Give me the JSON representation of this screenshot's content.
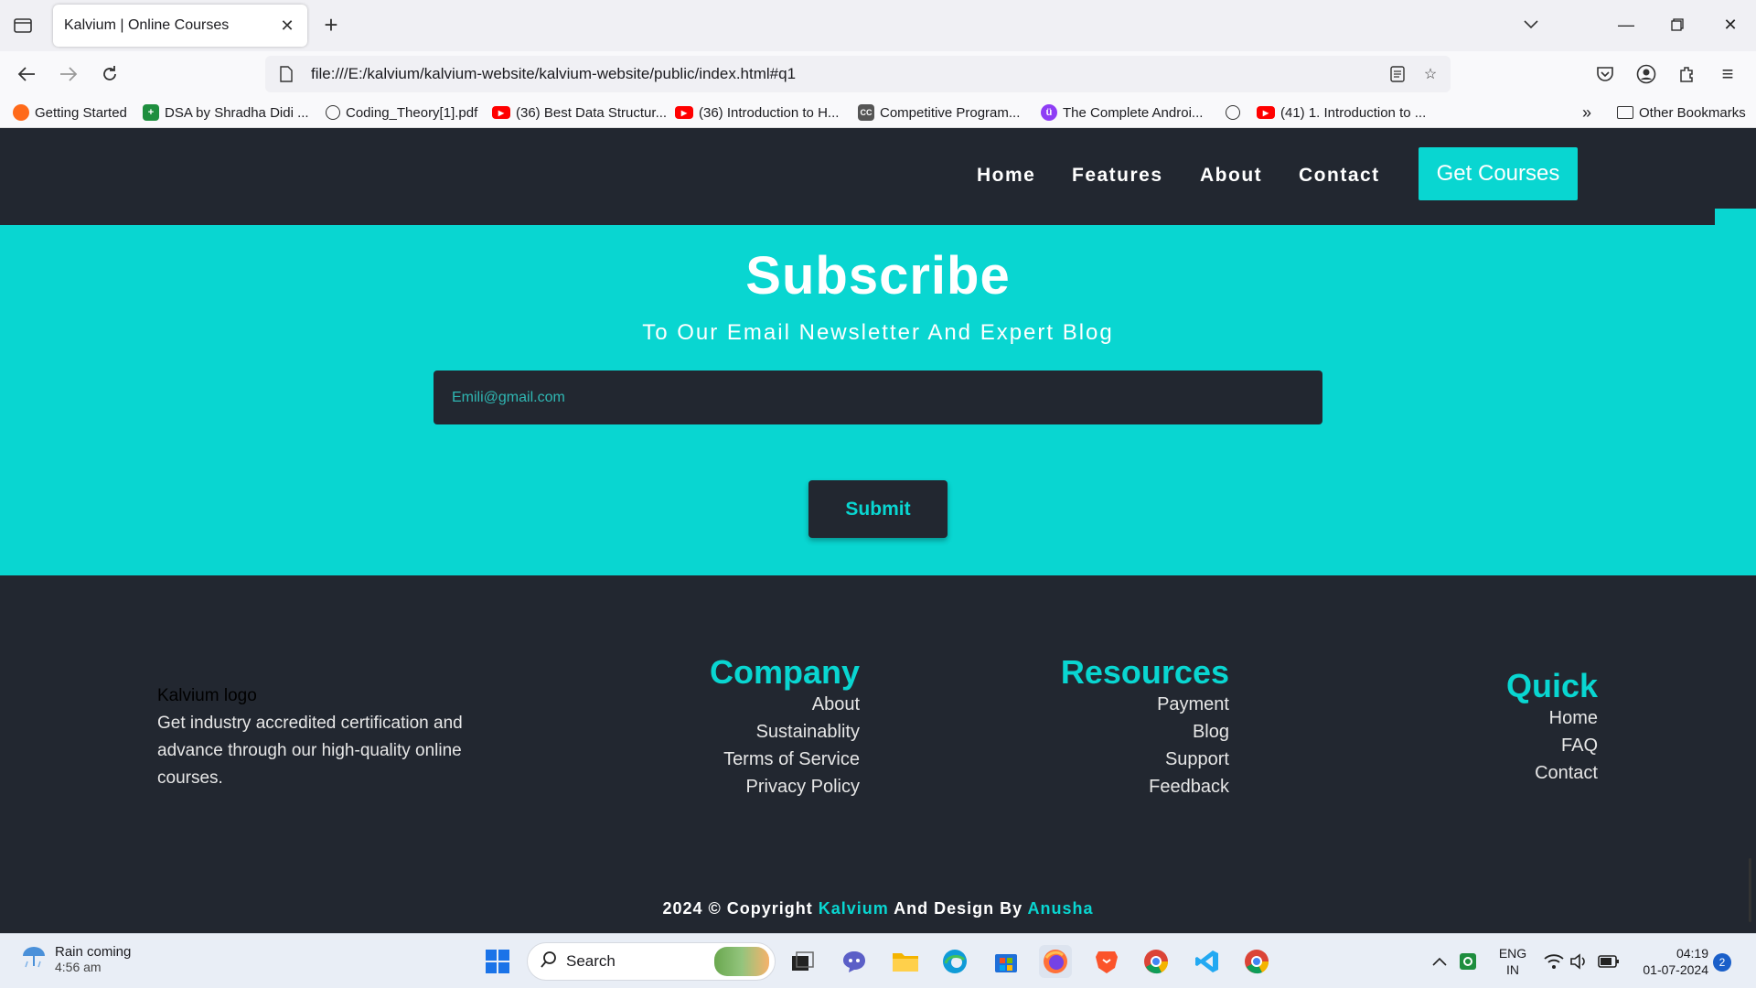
{
  "browser": {
    "tab_title": "Kalvium | Online Courses",
    "url": "file:///E:/kalvium/kalvium-website/kalvium-website/public/index.html#q1",
    "bookmarks": [
      "Getting Started",
      "DSA by Shradha Didi ...",
      "Coding_Theory[1].pdf",
      "(36) Best Data Structur...",
      "(36) Introduction to H...",
      "Competitive Program...",
      "The Complete Androi...",
      "",
      "(41) 1. Introduction to ..."
    ],
    "other_bookmarks": "Other Bookmarks"
  },
  "site": {
    "menu": [
      "Home",
      "Features",
      "About",
      "Contact"
    ],
    "cta": "Get Courses",
    "subscribe": {
      "title": "Subscribe",
      "subtitle": "To Our Email Newsletter And Expert Blog",
      "email_placeholder": "Emili@gmail.com",
      "submit": "Submit"
    },
    "footer": {
      "logo_alt": "Kalvium logo",
      "about": "Get industry accredited certification and advance through our high-quality online courses.",
      "columns": [
        {
          "title": "Company",
          "links": [
            "About",
            "Sustainablity",
            "Terms of Service",
            "Privacy Policy"
          ]
        },
        {
          "title": "Resources",
          "links": [
            "Payment",
            "Blog",
            "Support",
            "Feedback"
          ]
        },
        {
          "title": "Quick",
          "links": [
            "Home",
            "FAQ",
            "Contact"
          ]
        }
      ],
      "copyright": {
        "prefix": "2024 © Copyright",
        "brand": "Kalvium",
        "middle": "And Design By",
        "designer": "Anusha"
      }
    },
    "colors": {
      "accent": "#09d6d1",
      "dark": "#222730"
    }
  },
  "taskbar": {
    "weather_line1": "Rain coming",
    "weather_line2": "4:56 am",
    "search_label": "Search",
    "lang_line1": "ENG",
    "lang_line2": "IN",
    "time": "04:19",
    "date": "01-07-2024",
    "notification_count": "2"
  }
}
